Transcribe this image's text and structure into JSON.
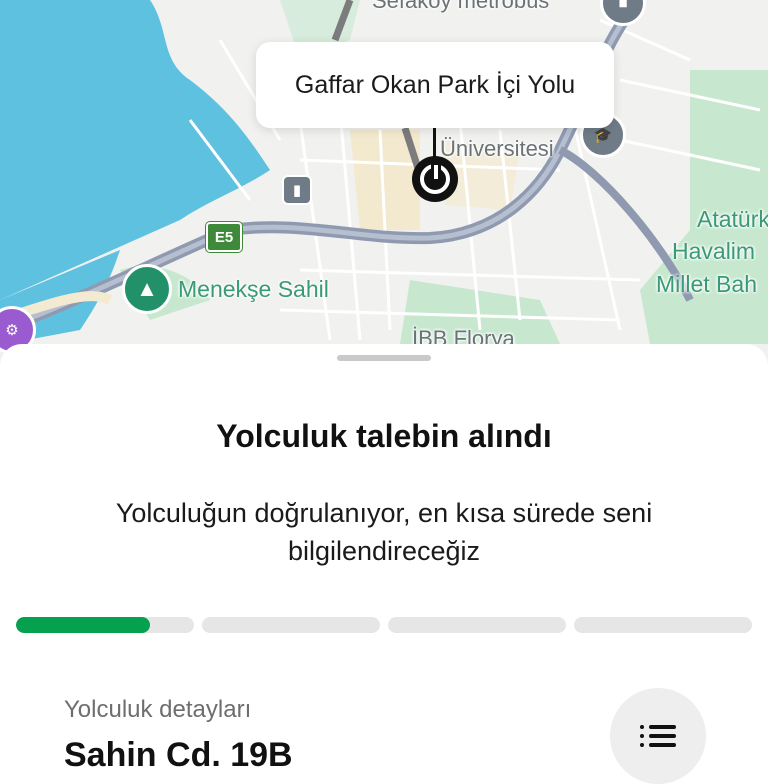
{
  "map": {
    "callout_text": "Gaffar Okan Park İçi Yolu",
    "labels": {
      "metrobus": "Sefaköy metrobüs",
      "university": "Üniversitesi",
      "airport_line1": "Atatürk",
      "airport_line2": "Havalim",
      "airport_line3": "Millet Bah",
      "menekse": "Menekşe Sahil",
      "ibb": "İBB Florya"
    },
    "road_shield": "E5",
    "colors": {
      "water": "#5ec1df",
      "park": "#c7e8cf",
      "road": "#9aa3b5",
      "pin": "#111111"
    }
  },
  "sheet": {
    "title": "Yolculuk talebin alındı",
    "subtitle": "Yolculuğun doğrulanıyor, en kısa sürede seni bilgilendireceğiz",
    "progress": {
      "segments": 4,
      "active_segment": 1,
      "active_fraction": 0.75,
      "color": "#06a14e"
    },
    "details_label": "Yolculuk detayları",
    "details_value": "Sahin Cd. 19B",
    "menu_icon": "list-icon"
  }
}
